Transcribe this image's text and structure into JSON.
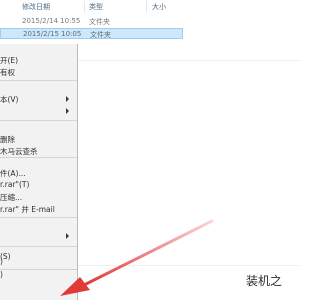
{
  "columns": {
    "date_modified": "修改日期",
    "type": "类型",
    "size": "大小"
  },
  "files": [
    {
      "date": "2015/2/14 10:55",
      "type": "文件夹",
      "selected": false
    },
    {
      "date": "2015/2/15 10:05",
      "type": "文件夹",
      "selected": true
    }
  ],
  "menu": {
    "items": [
      {
        "label": "开(E)"
      },
      {
        "label": "有权"
      },
      {
        "label": "本(V)",
        "submenu": true
      },
      {
        "label": "",
        "submenu": true
      },
      {
        "label": "删除"
      },
      {
        "label": "木马云查杀"
      },
      {
        "label": "件(A)..."
      },
      {
        "label": "r.rar\"(T)"
      },
      {
        "label": "压缩..."
      },
      {
        "label": "r.rar\" 并 E-mail"
      },
      {
        "label": "",
        "submenu": true
      },
      {
        "label": ")"
      },
      {
        "label": "(S)"
      },
      {
        "label": ")"
      }
    ]
  },
  "colors": {
    "annotation_arrow": "#e03a3a",
    "selection": "#cde8fb"
  },
  "watermark": "装机之"
}
